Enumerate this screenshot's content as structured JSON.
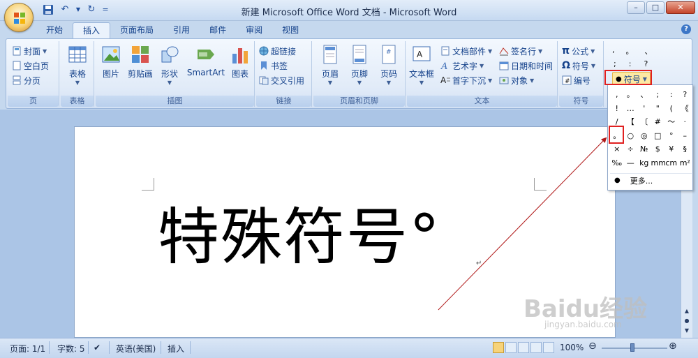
{
  "window": {
    "title": "新建 Microsoft Office Word 文档 - Microsoft Word",
    "controls": [
      "–",
      "□",
      "✕"
    ]
  },
  "qat": {
    "separator": "="
  },
  "tabs": [
    {
      "label": "开始",
      "active": false
    },
    {
      "label": "插入",
      "active": true
    },
    {
      "label": "页面布局",
      "active": false
    },
    {
      "label": "引用",
      "active": false
    },
    {
      "label": "邮件",
      "active": false
    },
    {
      "label": "审阅",
      "active": false
    },
    {
      "label": "视图",
      "active": false
    }
  ],
  "ribbon": {
    "pages": {
      "label": "页",
      "items": [
        "封面",
        "空白页",
        "分页"
      ]
    },
    "table": {
      "label": "表格",
      "button": "表格"
    },
    "illustrations": {
      "label": "插图",
      "buttons": [
        "图片",
        "剪贴画",
        "形状",
        "SmartArt",
        "图表"
      ]
    },
    "links": {
      "label": "链接",
      "items": [
        "超链接",
        "书签",
        "交叉引用"
      ]
    },
    "header_footer": {
      "label": "页眉和页脚",
      "buttons": [
        "页眉",
        "页脚",
        "页码"
      ]
    },
    "text": {
      "label": "文本",
      "textbox": "文本框",
      "items_col1": [
        "文档部件",
        "艺术字",
        "首字下沉"
      ],
      "items_col2": [
        "签名行",
        "日期和时间",
        "对象"
      ]
    },
    "symbols": {
      "label": "符号",
      "items": [
        "公式",
        "符号",
        "编号"
      ]
    },
    "special_symbol_button": "符号",
    "quick_symbols_row1": [
      ",",
      "。",
      "、"
    ],
    "quick_symbols_row2": [
      ";",
      ":",
      "?"
    ]
  },
  "symbol_panel": {
    "rows": [
      [
        ",",
        "。",
        "、",
        ";",
        ":",
        "?"
      ],
      [
        "!",
        "…",
        "'",
        "\"",
        "(",
        "《"
      ],
      [
        "/",
        "【",
        "〔",
        "#",
        "～",
        "·"
      ],
      [
        "。",
        "○",
        "◎",
        "□",
        "°",
        "–"
      ],
      [
        "×",
        "÷",
        "№",
        "$",
        "¥",
        "§"
      ],
      [
        "‰",
        "—",
        "kg",
        "mm",
        "cm",
        "m²"
      ]
    ],
    "more_label": "更多..."
  },
  "document": {
    "body_text": "特殊符号°",
    "para_mark": "↵"
  },
  "statusbar": {
    "page": "页面: 1/1",
    "words": "字数: 5",
    "language": "英语(美国)",
    "mode": "插入",
    "zoom": "100%"
  },
  "watermark": {
    "main": "Baidu经验",
    "sub": "jingyan.baidu.com"
  },
  "colors": {
    "accent": "#15428b",
    "highlight": "#e02020",
    "ribbon_bg": "#e1ebf8"
  }
}
